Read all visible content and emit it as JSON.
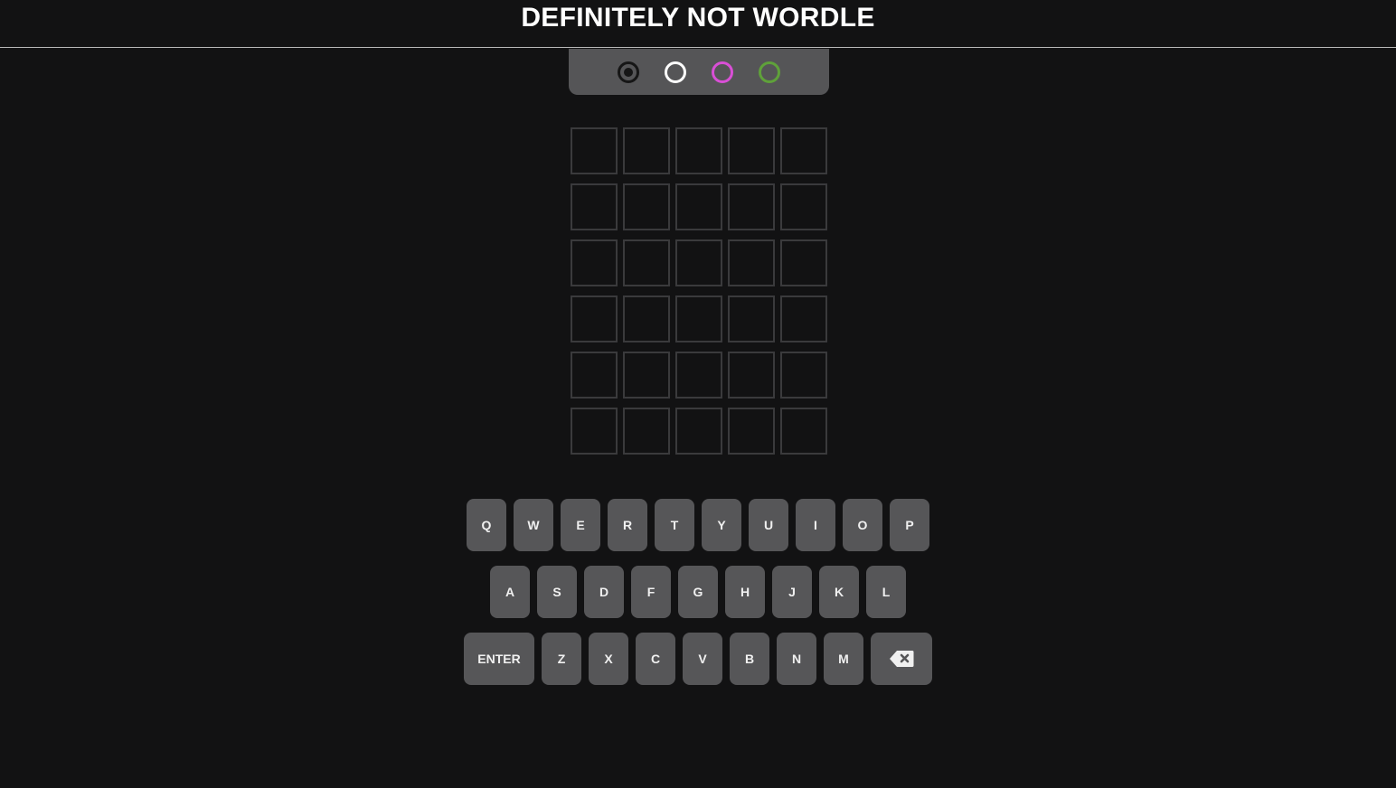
{
  "header": {
    "title": "DEFINITELY NOT WORDLE"
  },
  "color_picker": {
    "swatches": [
      {
        "name": "black",
        "color": "#1a1a1a",
        "selected": true
      },
      {
        "name": "white",
        "color": "#ffffff",
        "selected": false
      },
      {
        "name": "magenta",
        "color": "#d94fd6",
        "selected": false
      },
      {
        "name": "green",
        "color": "#5fa13a",
        "selected": false
      }
    ]
  },
  "board": {
    "rows": [
      [
        "",
        "",
        "",
        "",
        ""
      ],
      [
        "",
        "",
        "",
        "",
        ""
      ],
      [
        "",
        "",
        "",
        "",
        ""
      ],
      [
        "",
        "",
        "",
        "",
        ""
      ],
      [
        "",
        "",
        "",
        "",
        ""
      ],
      [
        "",
        "",
        "",
        "",
        ""
      ]
    ]
  },
  "keyboard": {
    "row1": [
      "Q",
      "W",
      "E",
      "R",
      "T",
      "Y",
      "U",
      "I",
      "O",
      "P"
    ],
    "row2": [
      "A",
      "S",
      "D",
      "F",
      "G",
      "H",
      "J",
      "K",
      "L"
    ],
    "row3": [
      "Z",
      "X",
      "C",
      "V",
      "B",
      "N",
      "M"
    ],
    "enter_label": "ENTER",
    "backspace_icon": "backspace-icon"
  },
  "colors": {
    "background": "#121213",
    "tile_border": "#3a3a3c",
    "key_background": "#565658"
  }
}
